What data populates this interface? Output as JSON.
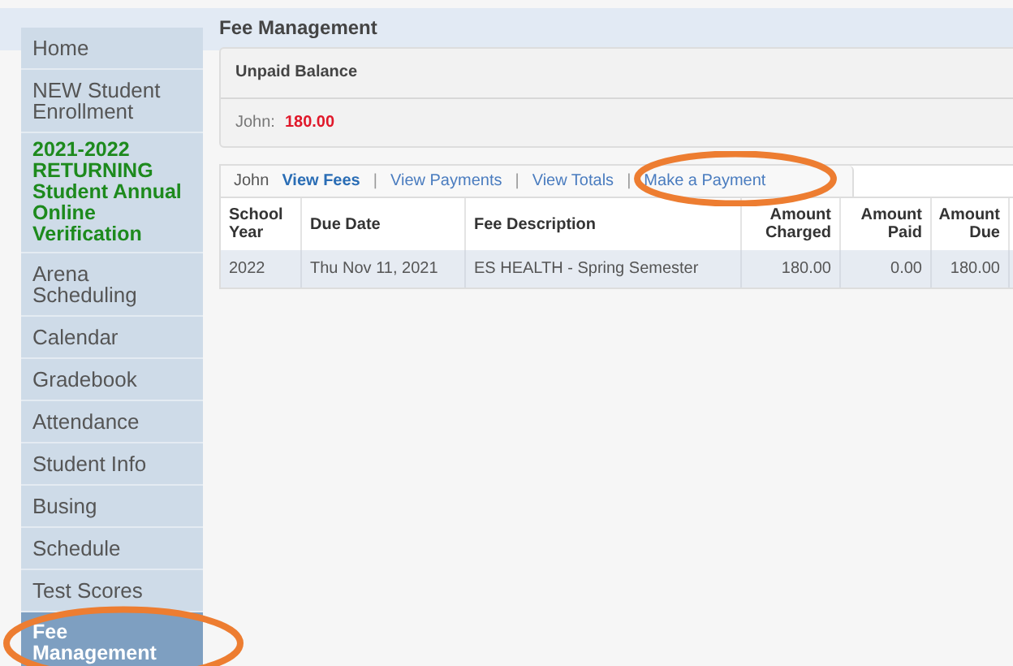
{
  "nav": [
    {
      "label": "Home",
      "kind": "plain",
      "selected": false,
      "circled": false
    },
    {
      "label": "NEW Student Enrollment",
      "kind": "plain",
      "selected": false,
      "circled": false
    },
    {
      "label": "2021-2022 RETURNING",
      "label2": "Student Annual Online Verification",
      "kind": "highlight",
      "selected": false,
      "circled": false
    },
    {
      "label": "Arena Scheduling",
      "kind": "plain",
      "selected": false,
      "circled": false
    },
    {
      "label": "Calendar",
      "kind": "plain",
      "selected": false,
      "circled": false
    },
    {
      "label": "Gradebook",
      "kind": "plain",
      "selected": false,
      "circled": false
    },
    {
      "label": "Attendance",
      "kind": "plain",
      "selected": false,
      "circled": false
    },
    {
      "label": "Student Info",
      "kind": "plain",
      "selected": false,
      "circled": false
    },
    {
      "label": "Busing",
      "kind": "plain",
      "selected": false,
      "circled": false
    },
    {
      "label": "Schedule",
      "kind": "plain",
      "selected": false,
      "circled": false
    },
    {
      "label": "Test Scores",
      "kind": "plain",
      "selected": false,
      "circled": false
    },
    {
      "label": "Fee Management",
      "kind": "plain",
      "selected": true,
      "circled": true
    }
  ],
  "page_title": "Fee Management",
  "balance": {
    "title": "Unpaid Balance",
    "student": "John:",
    "amount": "180.00"
  },
  "tabs": {
    "student": "John",
    "separators": [
      "|",
      "|",
      "|"
    ],
    "items": [
      {
        "label": "View Fees",
        "selected": true,
        "circled": false
      },
      {
        "label": "View Payments",
        "selected": false,
        "circled": false
      },
      {
        "label": "View Totals",
        "selected": false,
        "circled": false
      },
      {
        "label": "Make a Payment",
        "selected": false,
        "circled": true
      }
    ]
  },
  "table": {
    "columns": [
      {
        "label": "School Year",
        "kind": "text"
      },
      {
        "label": "Due Date",
        "kind": "text"
      },
      {
        "label": "Fee Description",
        "kind": "text"
      },
      {
        "label": "Amount Charged",
        "kind": "amount"
      },
      {
        "label": "Amount Paid",
        "kind": "amount"
      },
      {
        "label": "Amount Due",
        "kind": "amount"
      }
    ],
    "rows": [
      [
        "2022",
        "Thu Nov 11, 2021",
        "ES HEALTH - Spring Semester",
        "180.00",
        "0.00",
        "180.00"
      ]
    ]
  }
}
